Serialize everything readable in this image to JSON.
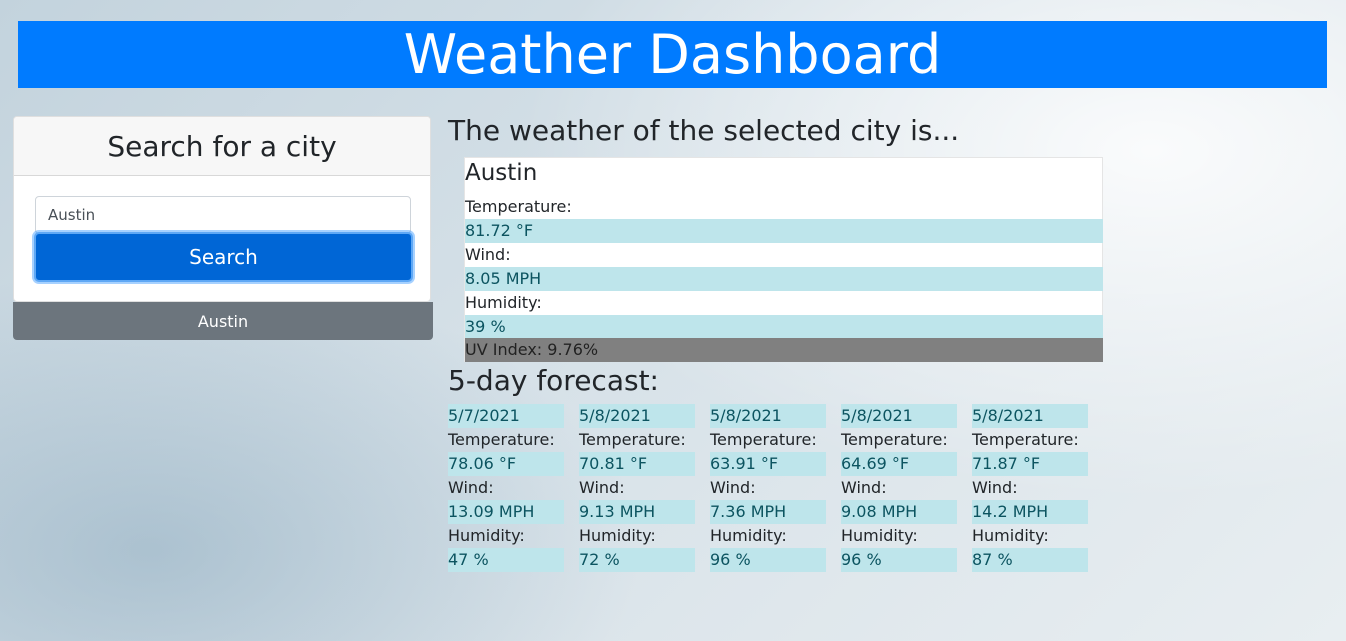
{
  "header": {
    "title": "Weather Dashboard"
  },
  "search": {
    "card_title": "Search for a city",
    "input_value": "Austin",
    "button_label": "Search",
    "history": [
      "Austin"
    ]
  },
  "current": {
    "heading": "The weather of the selected city is...",
    "city": "Austin",
    "temperature_label": "Temperature:",
    "temperature": "81.72 °F",
    "wind_label": "Wind:",
    "wind": "8.05 MPH",
    "humidity_label": "Humidity:",
    "humidity": "39 %",
    "uv": "UV Index: 9.76%"
  },
  "forecast": {
    "heading": "5-day forecast:",
    "temperature_label": "Temperature:",
    "wind_label": "Wind:",
    "humidity_label": "Humidity:",
    "days": [
      {
        "date": "5/7/2021",
        "temperature": "78.06 °F",
        "wind": "13.09 MPH",
        "humidity": "47 %"
      },
      {
        "date": "5/8/2021",
        "temperature": "70.81 °F",
        "wind": "9.13 MPH",
        "humidity": "72 %"
      },
      {
        "date": "5/8/2021",
        "temperature": "63.91 °F",
        "wind": "7.36 MPH",
        "humidity": "96 %"
      },
      {
        "date": "5/8/2021",
        "temperature": "64.69 °F",
        "wind": "9.08 MPH",
        "humidity": "96 %"
      },
      {
        "date": "5/8/2021",
        "temperature": "71.87 °F",
        "wind": "14.2 MPH",
        "humidity": "87 %"
      }
    ]
  },
  "colors": {
    "header_bg": "#007bff",
    "button_bg": "#0066d6",
    "history_bg": "#6c757d",
    "value_bg": "#bee5eb",
    "value_text": "#0c5460",
    "uv_bg": "#808080"
  }
}
